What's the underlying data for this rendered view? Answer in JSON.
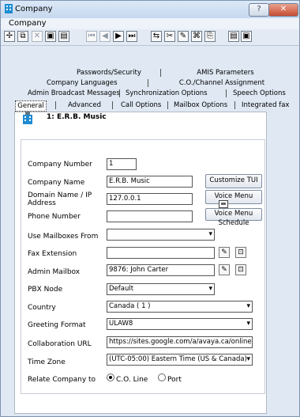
{
  "window": {
    "title": "Company",
    "help_label": "?",
    "close_label": "✕"
  },
  "menu": {
    "items": [
      "Company"
    ]
  },
  "toolbar": {
    "icons": [
      "✢",
      "⧉",
      "✕",
      "▣",
      "▤",
      "⏮",
      "◀",
      "▶",
      "⏭",
      "⇆",
      "✂",
      "✎",
      "⌘",
      "⎘",
      "▤",
      "▣"
    ]
  },
  "tabs": {
    "row1": [
      "Passwords/Security",
      "AMIS Parameters"
    ],
    "row2": [
      "Company Languages",
      "C.O./Channel Assignment"
    ],
    "row3": [
      "Admin Broadcast Messages",
      "Synchronization Options",
      "Speech Options"
    ],
    "row4": [
      "General",
      "Advanced",
      "Call Options",
      "Mailbox Options",
      "Integrated fax"
    ]
  },
  "header": {
    "text": "1: E.R.B. Music"
  },
  "form": {
    "company_number_label": "Company Number",
    "company_number": "1",
    "company_name_label": "Company Name",
    "company_name": "E.R.B. Music",
    "domain_label_1": "Domain Name / IP",
    "domain_label_2": "Address",
    "domain": "127.0.0.1",
    "phone_label": "Phone Number",
    "phone": "",
    "use_mailboxes_label": "Use Mailboxes From",
    "use_mailboxes": "",
    "fax_extension_label": "Fax Extension",
    "fax_extension": "",
    "admin_mailbox_label": "Admin Mailbox",
    "admin_mailbox": "9876: John Carter",
    "pbx_node_label": "PBX Node",
    "pbx_node": "Default",
    "country_label": "Country",
    "country": "Canada ( 1 )",
    "greeting_format_label": "Greeting Format",
    "greeting_format": "ULAW8",
    "collab_url_label": "Collaboration URL",
    "collab_url": "https://sites.google.com/a/avaya.ca/online-",
    "time_zone_label": "Time Zone",
    "time_zone": "(UTC-05:00) Eastern Time (US & Canada)",
    "relate_label": "Relate Company to",
    "radio_co": "C.O. Line",
    "radio_port": "Port"
  },
  "buttons": {
    "customize_tui": "Customize TUI",
    "voice_menu": "Voice Menu",
    "voice_menu_schedule": "Voice Menu Schedule"
  },
  "colors": {
    "window_background": "#dfe8f3",
    "title_bar": "#c6d8ee",
    "close_button": "#c74b33",
    "form_background": "#ffffff"
  }
}
